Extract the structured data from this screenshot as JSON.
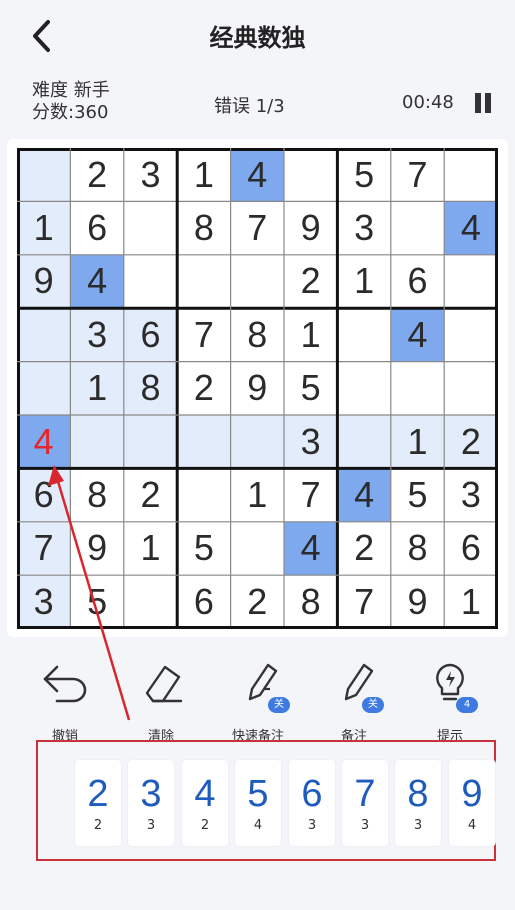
{
  "header": {
    "title": "经典数独"
  },
  "info": {
    "difficulty": "难度 新手",
    "score": "分数:360",
    "mistakes": "错误 1/3",
    "timer": "00:48"
  },
  "board": {
    "rows": [
      [
        "",
        "2",
        "3",
        "1",
        "4",
        "",
        "5",
        "7",
        ""
      ],
      [
        "1",
        "6",
        "",
        "8",
        "7",
        "9",
        "3",
        "",
        "4"
      ],
      [
        "9",
        "4",
        "",
        "",
        "",
        "2",
        "1",
        "6",
        ""
      ],
      [
        "",
        "3",
        "6",
        "7",
        "8",
        "1",
        "",
        "4",
        ""
      ],
      [
        "",
        "1",
        "8",
        "2",
        "9",
        "5",
        "",
        "",
        ""
      ],
      [
        "4",
        "",
        "",
        "",
        "",
        "3",
        "",
        "1",
        "2"
      ],
      [
        "6",
        "8",
        "2",
        "",
        "1",
        "7",
        "4",
        "5",
        "3"
      ],
      [
        "7",
        "9",
        "1",
        "5",
        "",
        "4",
        "2",
        "8",
        "6"
      ],
      [
        "3",
        "5",
        "",
        "6",
        "2",
        "8",
        "7",
        "9",
        "1"
      ]
    ],
    "selected": [
      5,
      0
    ],
    "error_cells": [
      [
        5,
        0
      ]
    ],
    "same_number_cells": [
      [
        0,
        4
      ],
      [
        1,
        8
      ],
      [
        2,
        1
      ],
      [
        3,
        7
      ],
      [
        6,
        6
      ],
      [
        7,
        5
      ]
    ],
    "colors": {
      "shade": "#e3ecfb",
      "highlight": "#7ea9ef",
      "error_text": "#e6262b",
      "annotation": "#d9262e"
    }
  },
  "tools": [
    {
      "label": "撤销",
      "icon": "undo-icon"
    },
    {
      "label": "清除",
      "icon": "eraser-icon"
    },
    {
      "label": "快速备注",
      "icon": "quick-note-pencil-icon",
      "badge": "关"
    },
    {
      "label": "备注",
      "icon": "note-pencil-icon",
      "badge": "关"
    },
    {
      "label": "提示",
      "icon": "lightbulb-icon",
      "badge": "4"
    }
  ],
  "numpad": [
    {
      "digit": "2",
      "remaining": "2"
    },
    {
      "digit": "3",
      "remaining": "3"
    },
    {
      "digit": "4",
      "remaining": "2"
    },
    {
      "digit": "5",
      "remaining": "4"
    },
    {
      "digit": "6",
      "remaining": "3"
    },
    {
      "digit": "7",
      "remaining": "3"
    },
    {
      "digit": "8",
      "remaining": "3"
    },
    {
      "digit": "9",
      "remaining": "4"
    }
  ]
}
